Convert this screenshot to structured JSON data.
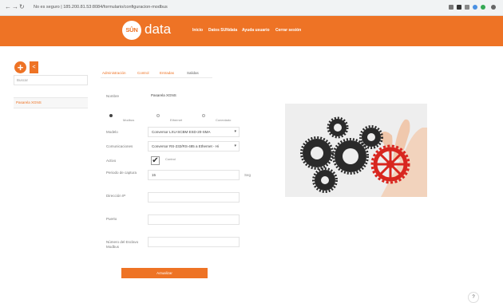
{
  "browser": {
    "address": "No es seguro | 185.200.81.53:8084/formulario/configuracion-modbus",
    "back_icon": "arrow-left",
    "forward_icon": "arrow-right",
    "reload_icon": "reload"
  },
  "header": {
    "logo_circle": "SÛN",
    "logo_text": "data",
    "nav": [
      "Inicio",
      "Datos SUNdata",
      "Ayuda usuario",
      "Cerrar sesión"
    ]
  },
  "sidebar": {
    "add_icon": "plus",
    "share_icon": "share",
    "search_placeholder": "Buscar",
    "items": [
      {
        "label": "Pasarela XGNS"
      }
    ]
  },
  "tabs": [
    {
      "label": "Administración"
    },
    {
      "label": "Control"
    },
    {
      "label": "Entradas"
    },
    {
      "label": "Salidas"
    }
  ],
  "form": {
    "name_label": "Nombre",
    "name_value": "Pasarela XGNS",
    "radios": [
      "Modbus",
      "Ethernet",
      "Conectado"
    ],
    "model_label": "Modelo",
    "model_value": "Conversor LXU-SCBM ESD-20-SMA",
    "comms_label": "Comunicaciones",
    "comms_value": "Conversor RS-232/RS-485 a Ethernet - Hi",
    "active_label": "Activo",
    "active_check_label": "Control",
    "period_label": "Periodo de captura",
    "period_value": "15",
    "period_unit": "Seg",
    "ip_label": "Dirección IP",
    "port_label": "Puerto",
    "modbus_label": "Número del Esclavo Modbus",
    "update_button": "Actualizar"
  },
  "colors": {
    "accent": "#ee7325",
    "gear_dark": "#2a2a2a",
    "gear_red": "#d8261f"
  },
  "help_label": "?"
}
